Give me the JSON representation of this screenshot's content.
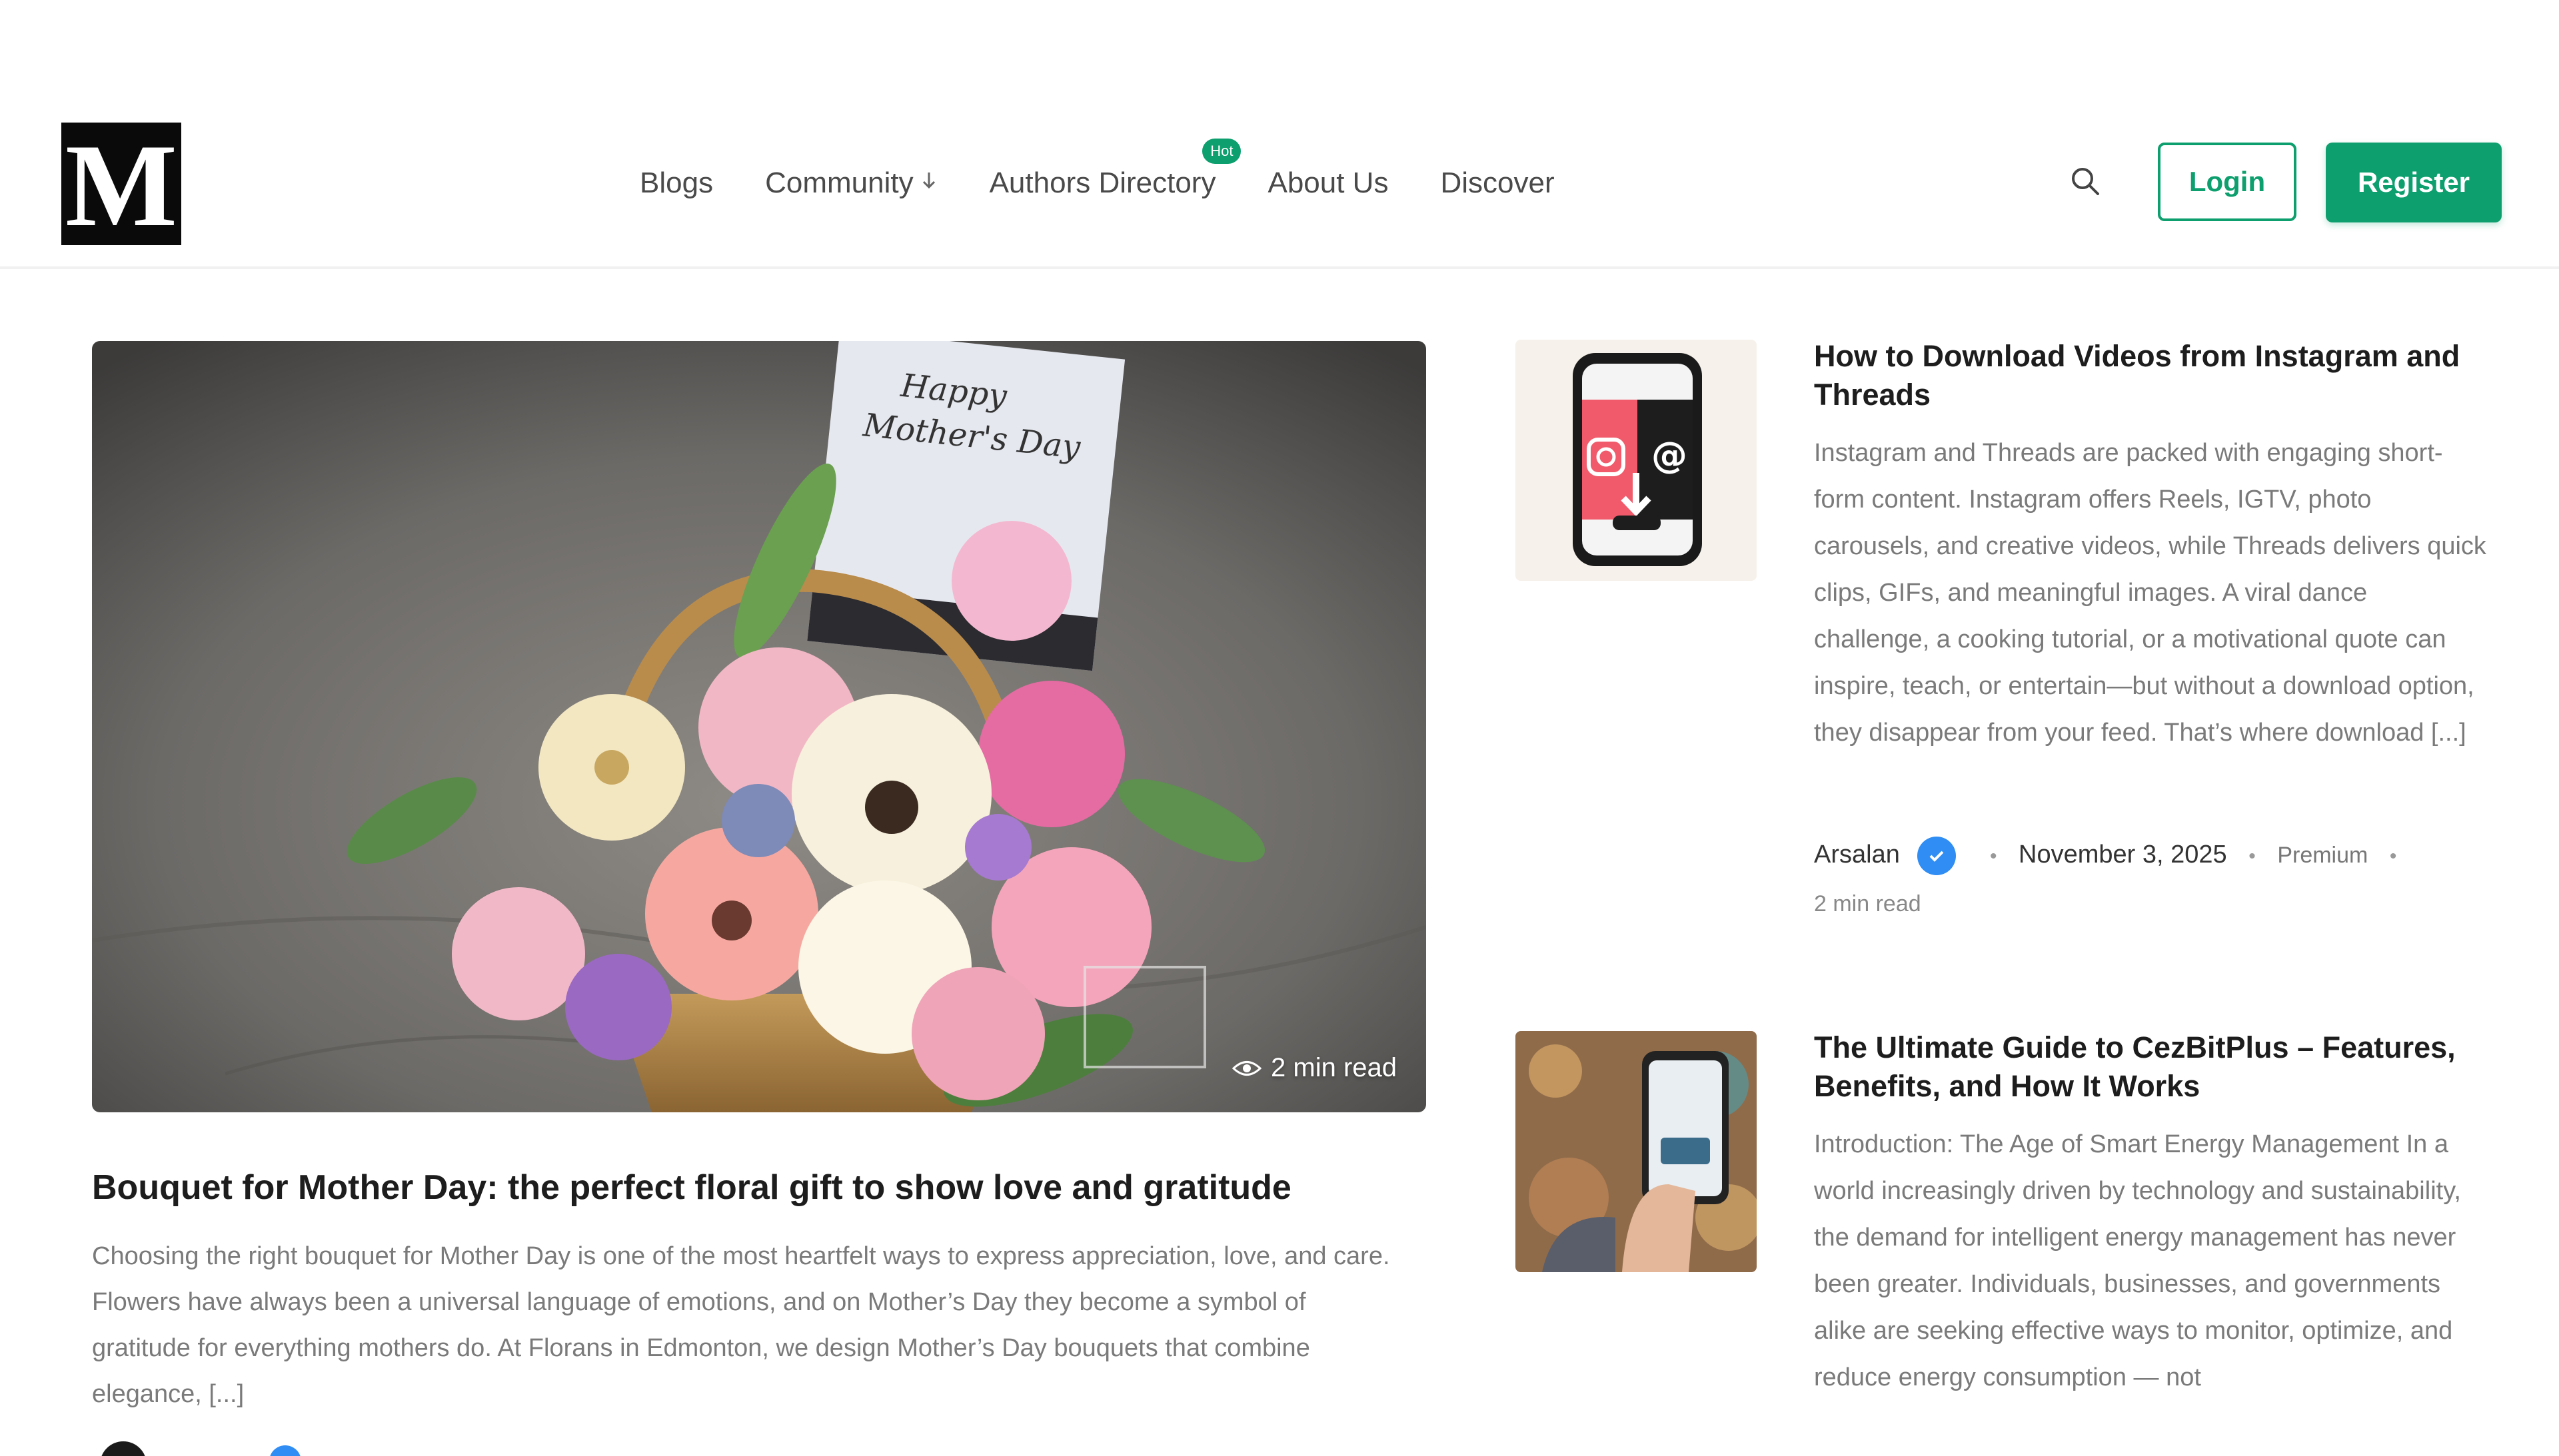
{
  "brand": {
    "logo_letter": "M"
  },
  "nav": {
    "items": [
      {
        "label": "Blogs"
      },
      {
        "label": "Community",
        "has_dropdown": true
      },
      {
        "label": "Authors Directory",
        "badge": "Hot"
      },
      {
        "label": "About Us"
      },
      {
        "label": "Discover"
      }
    ]
  },
  "header": {
    "search_icon": "search-icon",
    "login_label": "Login",
    "register_label": "Register"
  },
  "colors": {
    "accent": "#0e9f6e",
    "verified": "#2f8df4"
  },
  "featured": {
    "image_card_text": "Happy Mother's Day",
    "read_time": "2 min read",
    "title": "Bouquet for Mother Day: the perfect floral gift to show love and gratitude",
    "excerpt": "Choosing the right bouquet for Mother Day is one of the most heartfelt ways to express appreciation, love, and care. Flowers have always been a universal language of emotions, and on Mother’s Day they become a symbol of gratitude for everything mothers do. At Florans in Edmonton, we design Mother’s Day bouquets that combine elegance, [...]"
  },
  "posts": [
    {
      "title": "How to Download Videos from Instagram and Threads",
      "excerpt": "Instagram and Threads are packed with engaging short-form content. Instagram offers Reels, IGTV, photo carousels, and creative videos, while Threads delivers quick clips, GIFs, and meaningful images. A viral dance challenge, a cooking tutorial, or a motivational quote can inspire, teach, or entertain—but without a download option, they disappear from your feed. That’s where download [...]",
      "author": "Arsalan",
      "date": "November 3, 2025",
      "tag": "Premium",
      "read_time": "2 min read"
    },
    {
      "title": "The Ultimate Guide to CezBitPlus – Features, Benefits, and How It Works",
      "excerpt": "Introduction: The Age of Smart Energy Management In a world increasingly driven by technology and sustainability, the demand for intelligent energy management has never been greater. Individuals, businesses, and governments alike are seeking effective ways to monitor, optimize, and reduce energy consumption — not"
    }
  ]
}
